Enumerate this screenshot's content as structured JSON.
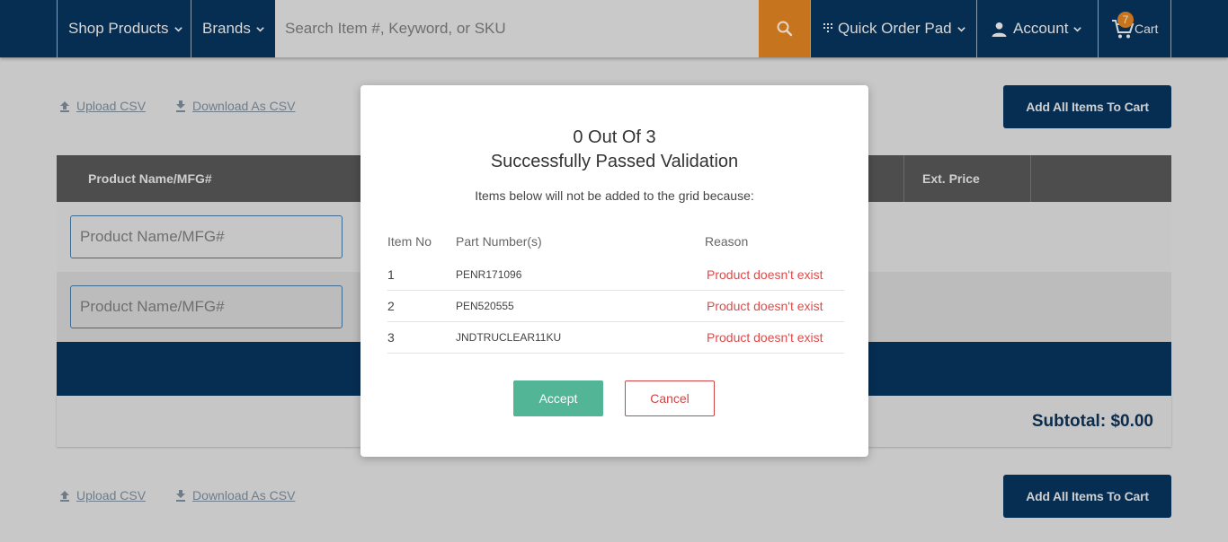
{
  "header": {
    "nav": {
      "shop_products": "Shop Products",
      "brands": "Brands",
      "quick_order_pad": "Quick Order Pad",
      "account": "Account",
      "cart": "Cart"
    },
    "search_placeholder": "Search Item #, Keyword, or SKU",
    "cart_count": "7",
    "colors": {
      "bar": "#062e53",
      "accent": "#c6741d"
    }
  },
  "toolbar": {
    "upload_csv": "Upload CSV",
    "download_csv": "Download As CSV",
    "add_all": "Add All Items To Cart"
  },
  "grid": {
    "columns": [
      "Product Name/MFG#",
      "Ext. Price"
    ],
    "input_placeholder": "Product Name/MFG#",
    "subtotal": "Subtotal: $0.00"
  },
  "modal": {
    "title_line1": "0 Out Of 3",
    "title_line2": "Successfully Passed Validation",
    "subtitle": "Items below will not be added to the grid because:",
    "headers": {
      "item_no": "Item No",
      "part_numbers": "Part Number(s)",
      "reason": "Reason"
    },
    "rows": [
      {
        "no": "1",
        "part": "PENR171096",
        "reason": "Product doesn't exist"
      },
      {
        "no": "2",
        "part": "PEN520555",
        "reason": "Product doesn't exist"
      },
      {
        "no": "3",
        "part": "JNDTRUCLEAR11KU",
        "reason": "Product doesn't exist"
      }
    ],
    "accept": "Accept",
    "cancel": "Cancel",
    "colors": {
      "accept": "#52b596",
      "error": "#e04a4a"
    }
  }
}
